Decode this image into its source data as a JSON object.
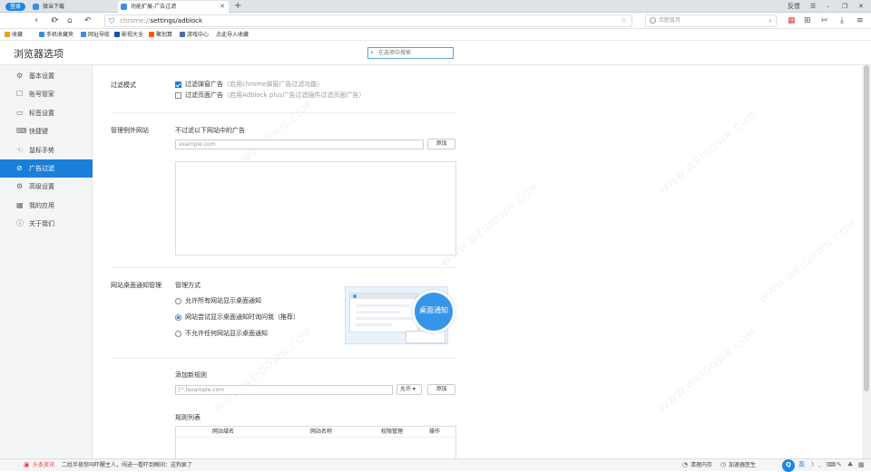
{
  "browser": {
    "login_label": "登录",
    "tabs": [
      {
        "label": "微当下载",
        "icon": "document-icon",
        "color": "#3a8ee6"
      },
      {
        "label": "功能扩展-广告过滤",
        "icon": "gear-icon",
        "color": "#3a8ee6"
      }
    ],
    "window_controls": {
      "feedback": "反馈",
      "menu": "☰",
      "minimize": "–",
      "restore": "❐",
      "close": "✕"
    },
    "url": {
      "scheme": "chrome://",
      "path": "settings/adblock"
    },
    "search_placeholder": "合肥蓝月",
    "bookmarks": [
      {
        "label": "收藏",
        "color": "#e8a21a"
      },
      {
        "label": "手机收藏夹",
        "color": "#3a8ee6"
      },
      {
        "label": "网址导航",
        "color": "#3a8ee6"
      },
      {
        "label": "影视大全",
        "color": "#1f4fa3"
      },
      {
        "label": "聚划算",
        "color": "#ff5a00"
      },
      {
        "label": "游戏中心",
        "color": "#4a6ea8"
      },
      {
        "label": "点此导入收藏",
        "color": "#ffffff"
      }
    ]
  },
  "page": {
    "title": "浏览器选项",
    "search_placeholder": "在选项中搜索"
  },
  "sidebar": {
    "items": [
      {
        "label": "基本设置",
        "icon": "gear-icon"
      },
      {
        "label": "账号管家",
        "icon": "account-icon"
      },
      {
        "label": "标签设置",
        "icon": "tab-icon"
      },
      {
        "label": "快捷键",
        "icon": "keyboard-icon"
      },
      {
        "label": "鼠标手势",
        "icon": "mouse-icon"
      },
      {
        "label": "广告过滤",
        "icon": "block-icon"
      },
      {
        "label": "高级设置",
        "icon": "settings-icon"
      },
      {
        "label": "我的应用",
        "icon": "apps-icon"
      },
      {
        "label": "关于我们",
        "icon": "info-icon"
      }
    ],
    "active_index": 5
  },
  "filter": {
    "section_title": "过滤模式",
    "options": [
      {
        "label": "过滤弹窗广告",
        "hint": "（启用chrome弹窗广告过滤功能）",
        "checked": true
      },
      {
        "label": "过滤页面广告",
        "hint": "（启用Adblock plus广告过滤插件过滤页面广告）",
        "checked": false
      }
    ]
  },
  "exceptions": {
    "section_title": "管理例外网站",
    "desc": "不过滤以下网站中的广告",
    "input_placeholder": "example.com",
    "add_label": "添加"
  },
  "notifications": {
    "section_title": "网站桌面通知管理",
    "manage_label": "管理方式",
    "options": [
      {
        "label": "允许所有网站显示桌面通知",
        "checked": false
      },
      {
        "label": "网站尝试显示桌面通知时询问我（推荐）",
        "checked": true
      },
      {
        "label": "不允许任何网站显示桌面通知",
        "checked": false
      }
    ],
    "bubble_label": "桌面通知"
  },
  "rules": {
    "add_title": "添加新规则",
    "input_placeholder": "[*.]example.com",
    "select_value": "允许",
    "add_label": "添加",
    "list_title": "规则列表",
    "columns": [
      "网站域名",
      "网站名称",
      "权限管理",
      "操作"
    ]
  },
  "watermark": "WWW.WEIDOWN.COM",
  "statusbar": {
    "news_label": "头条资讯",
    "news_text": "二姓半夜惊叫吓醒主人，闯进一看吓到瞬间：这狗疯了",
    "clean_label": "清理内存",
    "speed_label": "加速器医生"
  }
}
